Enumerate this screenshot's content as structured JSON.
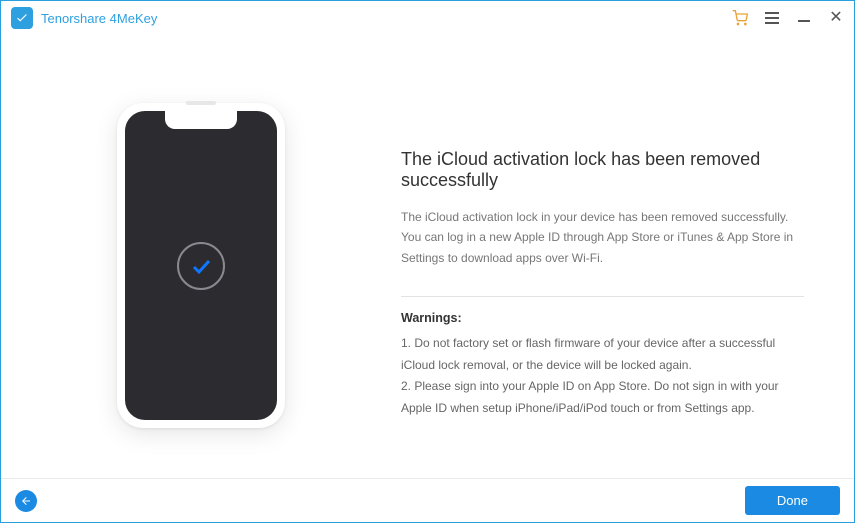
{
  "titlebar": {
    "app_title": "Tenorshare 4MeKey"
  },
  "content": {
    "heading": "The iCloud activation lock has been removed successfully",
    "description": "The iCloud activation lock in your device has been removed successfully. You can log in a new Apple ID through App Store or iTunes & App Store in Settings to download apps over Wi-Fi.",
    "warnings_title": "Warnings:",
    "warning1": "1. Do not factory set or flash firmware of your device after a successful iCloud lock removal, or the device will be locked again.",
    "warning2": "2. Please sign into your Apple ID on App Store. Do not sign in with your Apple ID when setup iPhone/iPad/iPod touch or from Settings app."
  },
  "footer": {
    "done_label": "Done"
  }
}
